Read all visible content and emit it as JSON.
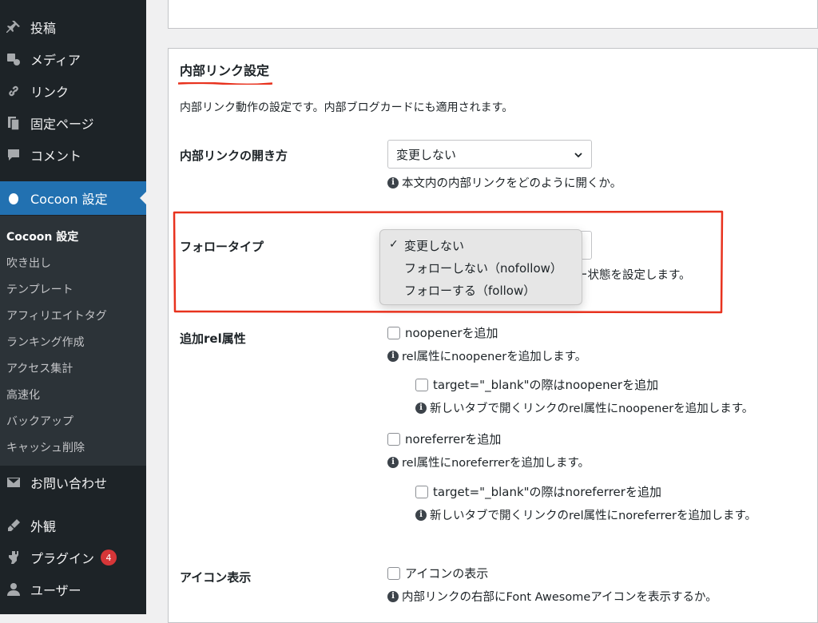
{
  "sidebar": {
    "items_top": [
      {
        "label": "投稿",
        "icon": "pin-icon"
      },
      {
        "label": "メディア",
        "icon": "media-icon"
      },
      {
        "label": "リンク",
        "icon": "link-icon"
      },
      {
        "label": "固定ページ",
        "icon": "page-icon"
      },
      {
        "label": "コメント",
        "icon": "comment-icon"
      }
    ],
    "current": {
      "label": "Cocoon 設定",
      "icon": "cocoon-icon"
    },
    "submenu": [
      "Cocoon 設定",
      "吹き出し",
      "テンプレート",
      "アフィリエイトタグ",
      "ランキング作成",
      "アクセス集計",
      "高速化",
      "バックアップ",
      "キャッシュ削除"
    ],
    "items_bottom": [
      {
        "label": "お問い合わせ",
        "icon": "mail-icon"
      },
      {
        "label": "外観",
        "icon": "brush-icon"
      },
      {
        "label": "プラグイン",
        "icon": "plugin-icon",
        "badge": "4"
      },
      {
        "label": "ユーザー",
        "icon": "user-icon"
      }
    ]
  },
  "section": {
    "title": "内部リンク設定",
    "description": "内部リンク動作の設定です。内部ブログカードにも適用されます。"
  },
  "open_method": {
    "label": "内部リンクの開き方",
    "select_value": "変更しない",
    "help": "本文内の内部リンクをどのように開くか。"
  },
  "follow_type": {
    "label": "フォロータイプ",
    "help_tail": "ー状態を設定します。",
    "options": [
      "変更しない",
      "フォローしない（nofollow）",
      "フォローする（follow）"
    ],
    "selected_index": 0
  },
  "rel": {
    "label": "追加rel属性",
    "noopener": "noopenerを追加",
    "noopener_help": "rel属性にnoopenerを追加します。",
    "noopener_blank": "target=\"_blank\"の際はnoopenerを追加",
    "noopener_blank_help": "新しいタブで開くリンクのrel属性にnoopenerを追加します。",
    "noreferrer": "noreferrerを追加",
    "noreferrer_help": "rel属性にnoreferrerを追加します。",
    "noreferrer_blank": "target=\"_blank\"の際はnoreferrerを追加",
    "noreferrer_blank_help": "新しいタブで開くリンクのrel属性にnoreferrerを追加します。"
  },
  "icon_display": {
    "label": "アイコン表示",
    "checkbox": "アイコンの表示",
    "help": "内部リンクの右部にFont Awesomeアイコンを表示するか。"
  },
  "colors": {
    "accent_red": "#e8321e",
    "wp_blue": "#2271b1",
    "sidebar_bg": "#1d2327"
  }
}
